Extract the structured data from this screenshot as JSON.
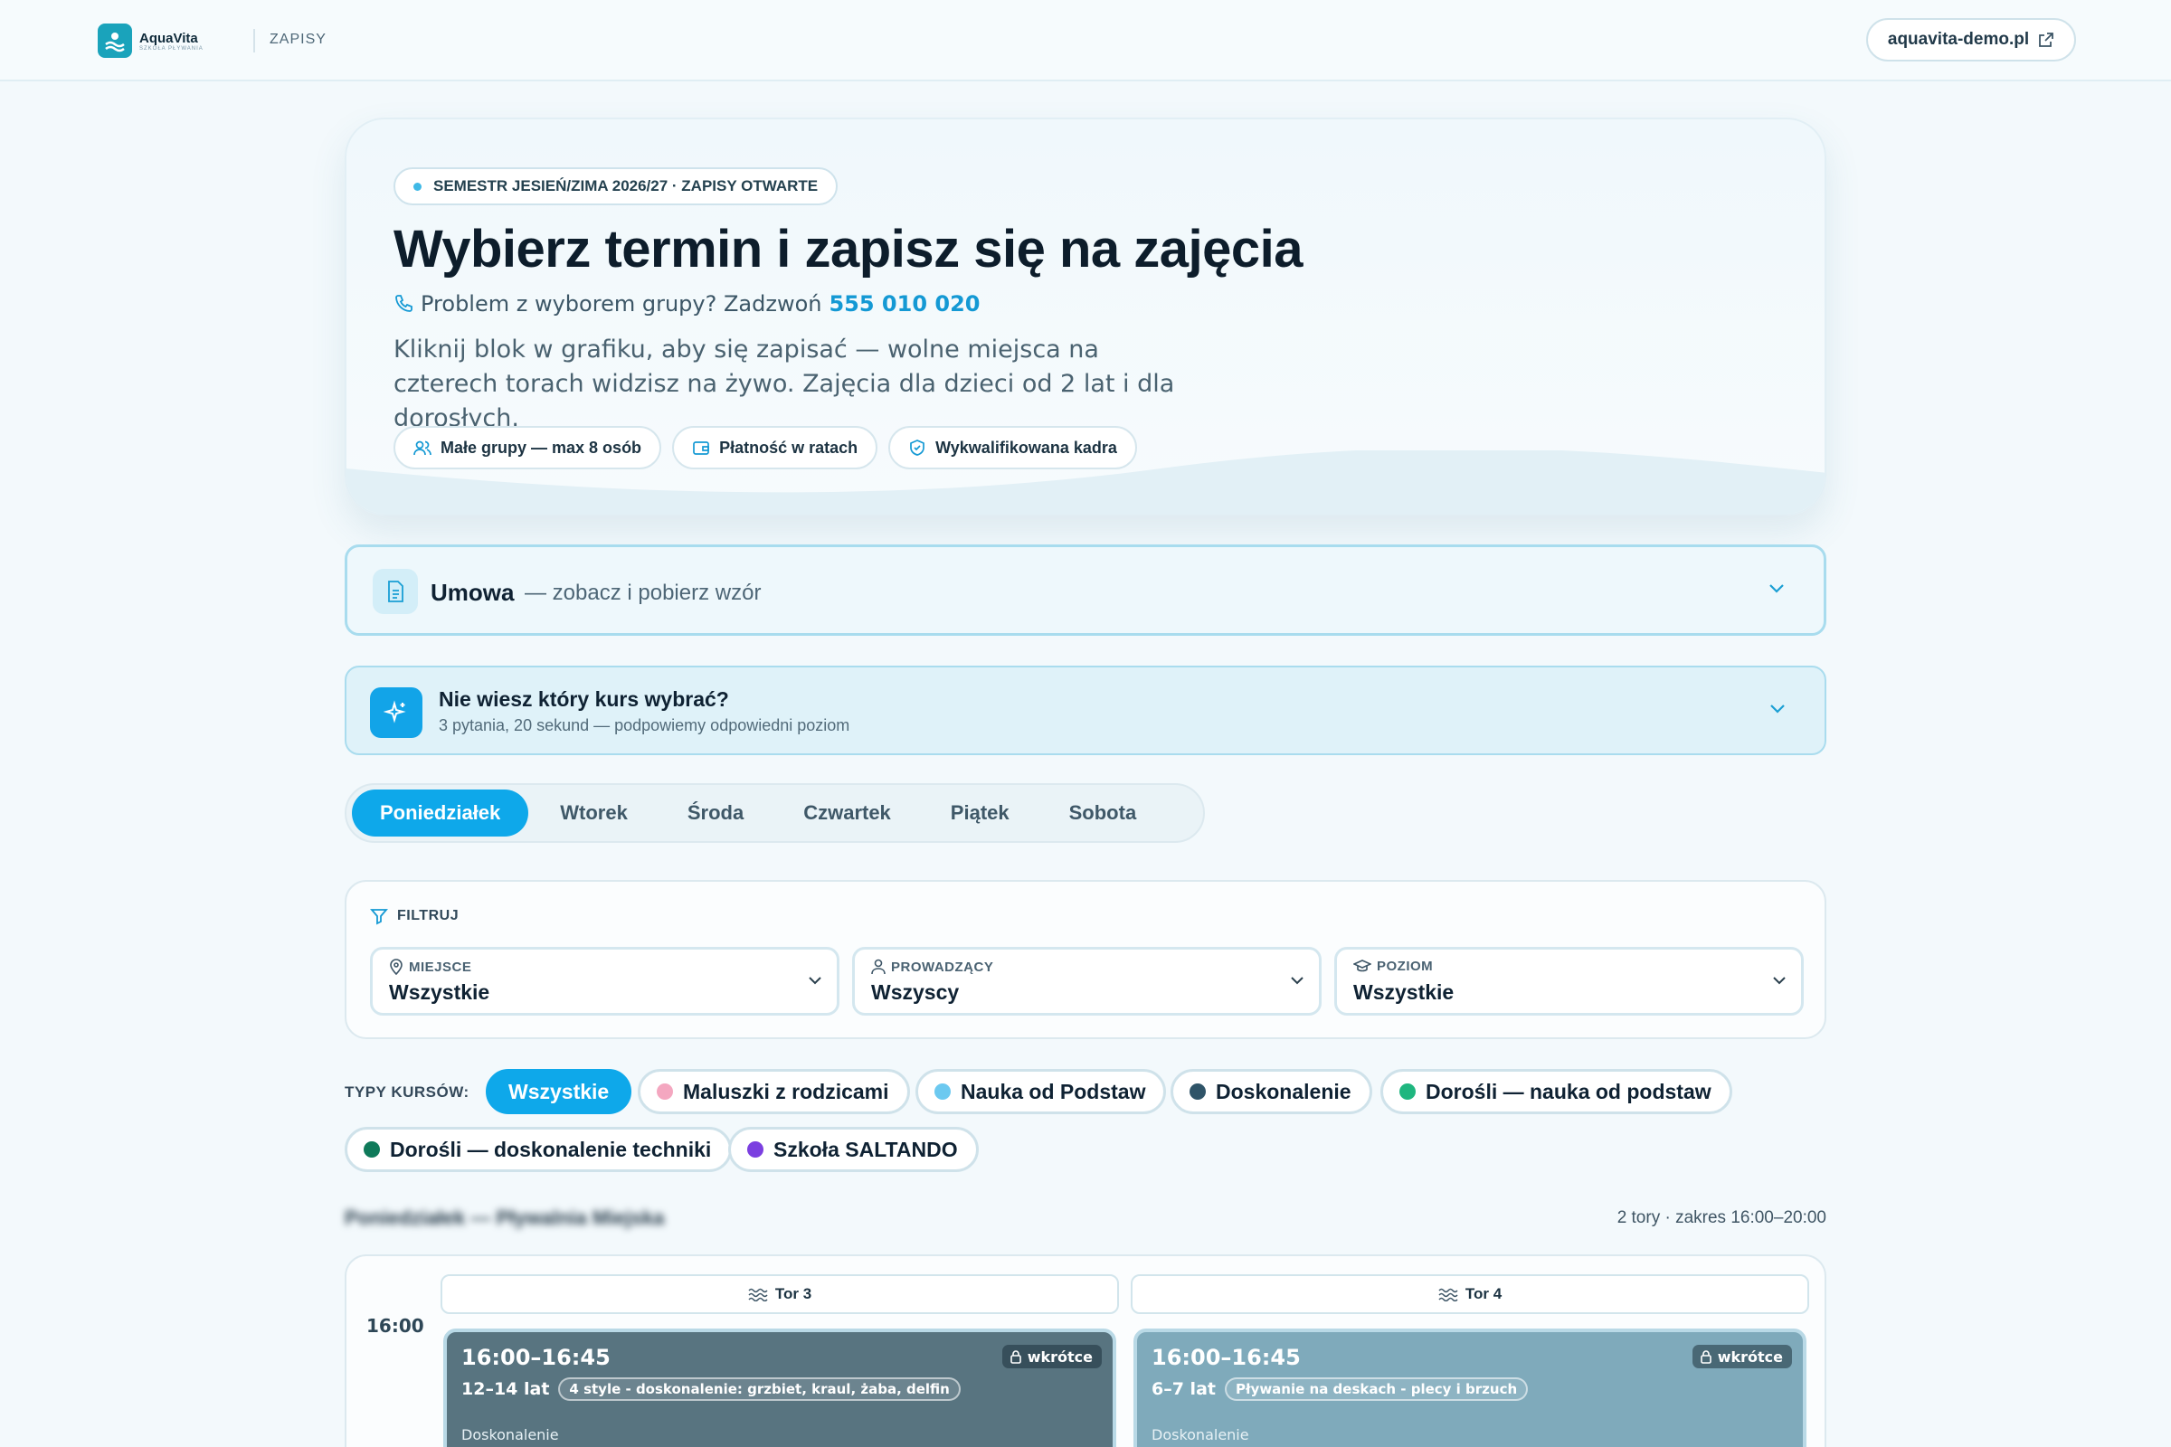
{
  "topbar": {
    "logo_name": "AquaVita",
    "logo_sub": "SZKOŁA PŁYWANIA",
    "section": "ZAPISY",
    "site_link": "aquavita-demo.pl"
  },
  "hero": {
    "semester": "SEMESTR JESIEŃ/ZIMA 2026/27 · ZAPISY OTWARTE",
    "title": "Wybierz termin i zapisz się na zajęcia",
    "phone_text": "Problem z wyborem grupy? Zadzwoń",
    "phone_number": "555 010 020",
    "description": "Kliknij blok w grafiku, aby się zapisać — wolne miejsca na czterech torach widzisz na żywo. Zajęcia dla dzieci od 2 lat i dla dorosłych.",
    "features": [
      "Małe grupy — max 8 osób",
      "Płatność w ratach",
      "Wykwalifikowana kadra"
    ]
  },
  "contract": {
    "title": "Umowa",
    "subtitle": "— zobacz i pobierz wzór"
  },
  "quiz": {
    "title": "Nie wiesz który kurs wybrać?",
    "subtitle": "3 pytania, 20 sekund — podpowiemy odpowiedni poziom"
  },
  "days": [
    "Poniedziałek",
    "Wtorek",
    "Środa",
    "Czwartek",
    "Piątek",
    "Sobota"
  ],
  "active_day": "Poniedziałek",
  "filter": {
    "label": "FILTRUJ",
    "location": {
      "label": "MIEJSCE",
      "value": "Wszystkie"
    },
    "instructor": {
      "label": "PROWADZĄCY",
      "value": "Wszyscy"
    },
    "level": {
      "label": "POZIOM",
      "value": "Wszystkie"
    }
  },
  "course_types": {
    "label": "TYPY KURSÓW:",
    "items": [
      {
        "label": "Wszystkie",
        "color": "#0ea8ea"
      },
      {
        "label": "Maluszki z rodzicami",
        "color": "#f4a7c0"
      },
      {
        "label": "Nauka od Podstaw",
        "color": "#6cc9f0"
      },
      {
        "label": "Doskonalenie",
        "color": "#2f5468"
      },
      {
        "label": "Dorośli — nauka od podstaw",
        "color": "#1fb67f"
      },
      {
        "label": "Dorośli — doskonalenie techniki",
        "color": "#0f7a5a"
      },
      {
        "label": "Szkoła SALTANDO",
        "color": "#7b3fe0"
      }
    ]
  },
  "schedule": {
    "title": "Poniedziałek — Pływalnia Miejska",
    "meta": "2 tory · zakres 16:00–20:00",
    "time": "16:00",
    "lanes": [
      {
        "name": "Tor 3",
        "block": {
          "time": "16:00–16:45",
          "age": "12–14 lat",
          "tag": "4 style - doskonalenie: grzbiet, kraul, żaba, delfin",
          "status": "wkrótce",
          "type": "Doskonalenie"
        }
      },
      {
        "name": "Tor 4",
        "block": {
          "time": "16:00–16:45",
          "age": "6–7 lat",
          "tag": "Pływanie na deskach - plecy i brzuch",
          "status": "wkrótce",
          "type": "Doskonalenie"
        }
      }
    ]
  }
}
